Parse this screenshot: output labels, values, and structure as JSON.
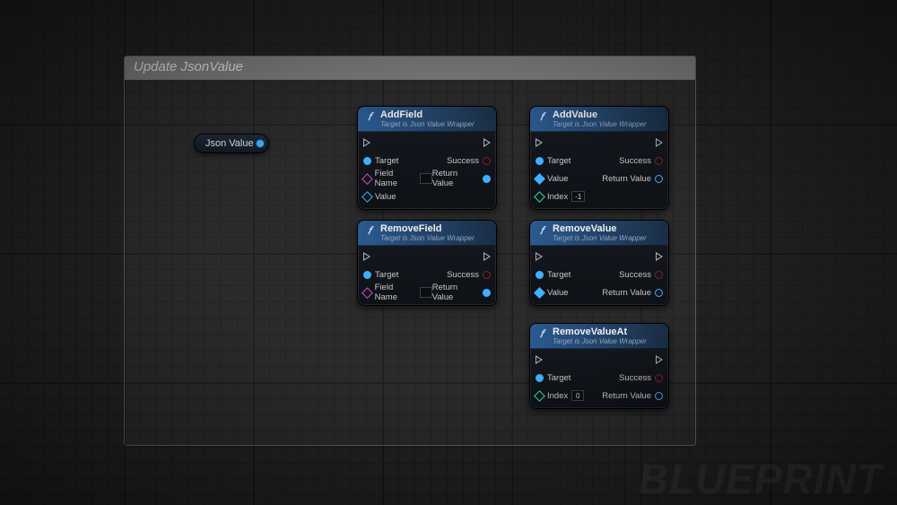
{
  "comment": {
    "title": "Update JsonValue"
  },
  "watermark": "BLUEPRINT",
  "var_node": {
    "label": "Json Value"
  },
  "nodes": {
    "addField": {
      "title": "AddField",
      "subtitle": "Target is Json Value Wrapper",
      "pins": {
        "target": "Target",
        "fieldName": "Field Name",
        "fieldNameDefault": "",
        "value": "Value",
        "success": "Success",
        "returnValue": "Return Value"
      }
    },
    "addValue": {
      "title": "AddValue",
      "subtitle": "Target is Json Value Wrapper",
      "pins": {
        "target": "Target",
        "value": "Value",
        "index": "Index",
        "indexDefault": "-1",
        "success": "Success",
        "returnValue": "Return Value"
      }
    },
    "removeField": {
      "title": "RemoveField",
      "subtitle": "Target is Json Value Wrapper",
      "pins": {
        "target": "Target",
        "fieldName": "Field Name",
        "fieldNameDefault": "",
        "success": "Success",
        "returnValue": "Return Value"
      }
    },
    "removeValue": {
      "title": "RemoveValue",
      "subtitle": "Target is Json Value Wrapper",
      "pins": {
        "target": "Target",
        "value": "Value",
        "success": "Success",
        "returnValue": "Return Value"
      }
    },
    "removeValueAt": {
      "title": "RemoveValueAt",
      "subtitle": "Target is Json Value Wrapper",
      "pins": {
        "target": "Target",
        "index": "Index",
        "indexDefault": "0",
        "success": "Success",
        "returnValue": "Return Value"
      }
    }
  }
}
